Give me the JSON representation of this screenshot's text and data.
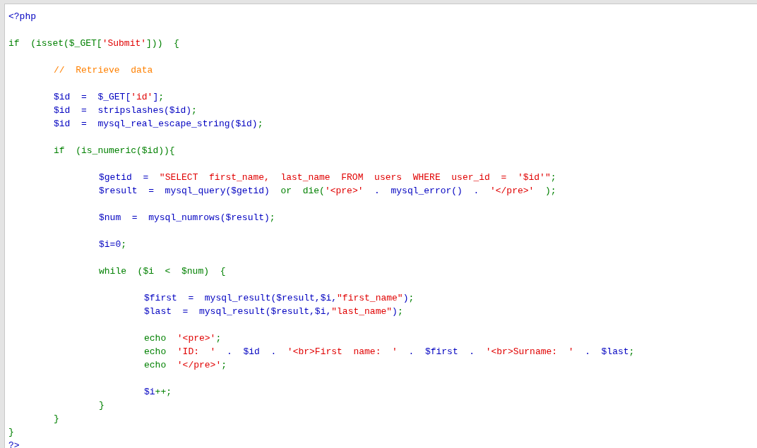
{
  "code_lines": [
    {
      "kind": "code",
      "tokens": [
        {
          "kind": "name",
          "text": "<?php"
        }
      ]
    },
    {
      "kind": "blank"
    },
    {
      "kind": "code",
      "tokens": [
        {
          "kind": "plain",
          "text": "if  (isset($_GET["
        },
        {
          "kind": "string",
          "text": "'Submit'"
        },
        {
          "kind": "plain",
          "text": "]))  {"
        }
      ],
      "children": [
        {
          "kind": "blank"
        },
        {
          "kind": "code",
          "tokens": [
            {
              "kind": "comment",
              "text": "//  Retrieve  data"
            }
          ]
        },
        {
          "kind": "blank"
        },
        {
          "kind": "code",
          "tokens": [
            {
              "kind": "name",
              "text": "$id  =  $_GET["
            },
            {
              "kind": "string",
              "text": "'id'"
            },
            {
              "kind": "name",
              "text": "]"
            },
            {
              "kind": "plain",
              "text": ";"
            }
          ]
        },
        {
          "kind": "code",
          "tokens": [
            {
              "kind": "name",
              "text": "$id  =  stripslashes($id)"
            },
            {
              "kind": "plain",
              "text": ";"
            }
          ]
        },
        {
          "kind": "code",
          "tokens": [
            {
              "kind": "name",
              "text": "$id  =  mysql_real_escape_string($id)"
            },
            {
              "kind": "plain",
              "text": ";"
            }
          ]
        },
        {
          "kind": "blank"
        },
        {
          "kind": "code",
          "tokens": [
            {
              "kind": "plain",
              "text": "if  (is_numeric($id)){"
            }
          ],
          "children": [
            {
              "kind": "blank"
            },
            {
              "kind": "code",
              "tokens": [
                {
                  "kind": "name",
                  "text": "$getid  =  "
                },
                {
                  "kind": "string",
                  "text": "\"SELECT  first_name,  last_name  FROM  users  WHERE  user_id  =  '$id'\""
                },
                {
                  "kind": "plain",
                  "text": ";"
                }
              ]
            },
            {
              "kind": "code",
              "tokens": [
                {
                  "kind": "name",
                  "text": "$result  =  mysql_query($getid)  "
                },
                {
                  "kind": "plain",
                  "text": "or  die("
                },
                {
                  "kind": "string",
                  "text": "'<pre>'"
                },
                {
                  "kind": "name",
                  "text": "  .  mysql_error()  .  "
                },
                {
                  "kind": "string",
                  "text": "'</pre>'"
                },
                {
                  "kind": "plain",
                  "text": "  );"
                }
              ]
            },
            {
              "kind": "blank"
            },
            {
              "kind": "code",
              "tokens": [
                {
                  "kind": "name",
                  "text": "$num  =  mysql_numrows($result)"
                },
                {
                  "kind": "plain",
                  "text": ";"
                }
              ]
            },
            {
              "kind": "blank"
            },
            {
              "kind": "code",
              "tokens": [
                {
                  "kind": "name",
                  "text": "$i=0"
                },
                {
                  "kind": "plain",
                  "text": ";"
                }
              ]
            },
            {
              "kind": "blank"
            },
            {
              "kind": "code",
              "tokens": [
                {
                  "kind": "plain",
                  "text": "while  ($i  <  $num)  {"
                }
              ],
              "children": [
                {
                  "kind": "blank"
                },
                {
                  "kind": "code",
                  "tokens": [
                    {
                      "kind": "name",
                      "text": "$first  =  mysql_result($result,$i,"
                    },
                    {
                      "kind": "string",
                      "text": "\"first_name\""
                    },
                    {
                      "kind": "name",
                      "text": ")"
                    },
                    {
                      "kind": "plain",
                      "text": ";"
                    }
                  ]
                },
                {
                  "kind": "code",
                  "tokens": [
                    {
                      "kind": "name",
                      "text": "$last  =  mysql_result($result,$i,"
                    },
                    {
                      "kind": "string",
                      "text": "\"last_name\""
                    },
                    {
                      "kind": "name",
                      "text": ")"
                    },
                    {
                      "kind": "plain",
                      "text": ";"
                    }
                  ]
                },
                {
                  "kind": "blank"
                },
                {
                  "kind": "code",
                  "tokens": [
                    {
                      "kind": "plain",
                      "text": "echo  "
                    },
                    {
                      "kind": "string",
                      "text": "'<pre>'"
                    },
                    {
                      "kind": "plain",
                      "text": ";"
                    }
                  ]
                },
                {
                  "kind": "code",
                  "tokens": [
                    {
                      "kind": "plain",
                      "text": "echo  "
                    },
                    {
                      "kind": "string",
                      "text": "'ID:  '"
                    },
                    {
                      "kind": "name",
                      "text": "  .  $id  .  "
                    },
                    {
                      "kind": "string",
                      "text": "'<br>First  name:  '"
                    },
                    {
                      "kind": "name",
                      "text": "  .  $first  .  "
                    },
                    {
                      "kind": "string",
                      "text": "'<br>Surname:  '"
                    },
                    {
                      "kind": "name",
                      "text": "  .  $last"
                    },
                    {
                      "kind": "plain",
                      "text": ";"
                    }
                  ]
                },
                {
                  "kind": "code",
                  "tokens": [
                    {
                      "kind": "plain",
                      "text": "echo  "
                    },
                    {
                      "kind": "string",
                      "text": "'</pre>'"
                    },
                    {
                      "kind": "plain",
                      "text": ";"
                    }
                  ]
                },
                {
                  "kind": "blank"
                },
                {
                  "kind": "code",
                  "tokens": [
                    {
                      "kind": "name",
                      "text": "$i"
                    },
                    {
                      "kind": "plain",
                      "text": "++;"
                    }
                  ]
                }
              ],
              "closing": [
                {
                  "kind": "plain",
                  "text": "}"
                }
              ]
            }
          ],
          "closing": [
            {
              "kind": "plain",
              "text": "}"
            }
          ]
        }
      ],
      "closing": [
        {
          "kind": "plain",
          "text": "}"
        }
      ]
    },
    {
      "kind": "code",
      "tokens": [
        {
          "kind": "name",
          "text": "?>"
        }
      ]
    }
  ]
}
